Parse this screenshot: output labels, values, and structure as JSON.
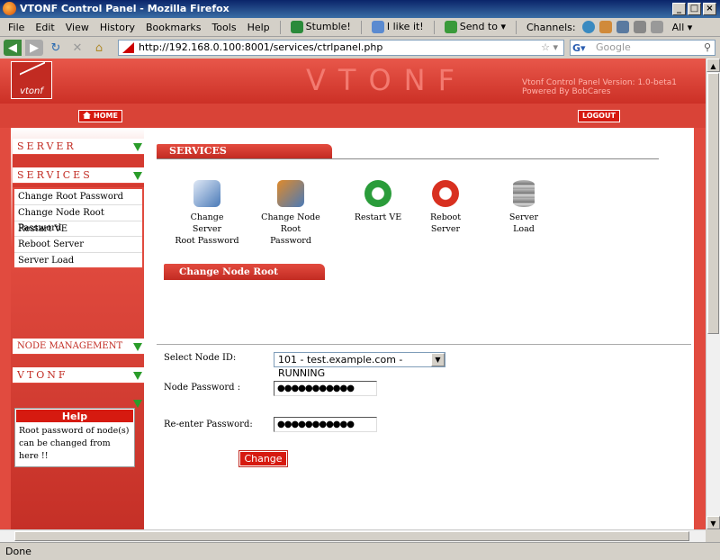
{
  "window": {
    "title": "VTONF Control Panel - Mozilla Firefox"
  },
  "menu": {
    "items": [
      "File",
      "Edit",
      "View",
      "History",
      "Bookmarks",
      "Tools",
      "Help"
    ],
    "stumble": "Stumble!",
    "ilike": "I like it!",
    "sendto": "Send to",
    "channels": "Channels:",
    "all": "All"
  },
  "nav": {
    "url": "http://192.168.0.100:8001/services/ctrlpanel.php",
    "search_placeholder": "Google"
  },
  "status": {
    "text": "Done"
  },
  "page": {
    "brand": "VTONF",
    "logo_text": "vtonf",
    "version_line1": "Vtonf Control Panel Version: 1.0-beta1",
    "version_line2": "Powered By BobCares",
    "home_label": "HOME",
    "logout_label": "LOGOUT"
  },
  "sidebar": {
    "server": "SERVER",
    "services": "SERVICES",
    "submenu": [
      "Change Root Password",
      "Change Node Root Password",
      "Restart VE",
      "Reboot Server",
      "Server Load"
    ],
    "node_management": "NODE MANAGEMENT",
    "vtonf": "VTONF",
    "help_title": "Help",
    "help_text": "Root password of node(s) can be changed from here !!"
  },
  "services": {
    "header": "SERVICES",
    "icons": [
      {
        "line1": "Change Server",
        "line2": "Root Password",
        "icon": "key-computer-icon",
        "color": "#4a7ab8"
      },
      {
        "line1": "Change Node",
        "line2": "Root Password",
        "icon": "key-cubes-icon",
        "color": "#e08a2a"
      },
      {
        "line1": "Restart VE",
        "line2": "",
        "icon": "green-refresh-icon",
        "color": "#2a9c3a"
      },
      {
        "line1": "Reboot Server",
        "line2": "",
        "icon": "red-refresh-icon",
        "color": "#d83020"
      },
      {
        "line1": "Server Load",
        "line2": "",
        "icon": "database-icon",
        "color": "#8a8a9a"
      }
    ]
  },
  "form": {
    "header": "Change Node Root Password",
    "node_label": "Select Node ID:",
    "node_value": "101 - test.example.com - RUNNING",
    "password_label": "Node Password :",
    "password_mask": "●●●●●●●●●●●",
    "reenter_label": "Re-enter Password:",
    "reenter_mask": "●●●●●●●●●●●",
    "submit_label": "Change"
  },
  "colors": {
    "accent": "#e14b3f",
    "dark_red": "#c22b22",
    "arrow_green": "#2a9c2a"
  }
}
